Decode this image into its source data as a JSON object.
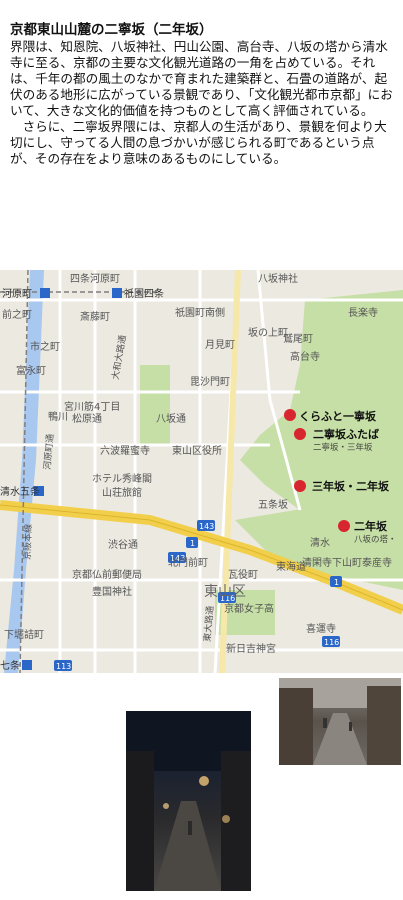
{
  "article": {
    "title": "京都東山山麓の二寧坂（二年坂）",
    "paragraph1": "界隈は、知恩院、八坂神社、円山公園、高台寺、八坂の塔から清水寺に至る、京都の主要な文化観光道路の一角を占めている。それは、千年の都の風土のなかで育まれた建築群と、石畳の道路が、起伏のある地形に広がっている景観であり、「文化観光都市京都」において、大きな文化的価値を持つものとして高く評価されている。",
    "paragraph2": "　さらに、二寧坂界隈には、京都人の生活があり、景観を何より大切にし、守ってる人間の息づかいが感じられる町であるという点が、その存在をより意味のあるものにしている。"
  },
  "map": {
    "labels": {
      "shijo_kawaramachi_top": "四条河原町",
      "kawaramachi_station": "河原町",
      "gion_shijo_station": "祇園四条",
      "yasaka_jinja": "八坂神社",
      "saitocho": "斎藤町",
      "nijocho": "前之町",
      "gion_machi_minamigawa": "祇園町南側",
      "chorakuji": "長楽寺",
      "sakanouecho": "坂の上町",
      "washiocho": "鷲尾町",
      "ichinocho": "市之町",
      "tsukimicho": "月見町",
      "kodaiji": "高台寺",
      "tominagacho": "富永町",
      "yamatooji": "大和大路通",
      "bishamoncho": "毘沙門町",
      "miyagawa4": "宮川筋4丁目",
      "yasaka_dori": "八坂通",
      "kawaramachi_dori": "河原町通",
      "matsubaracho": "松原通",
      "kamogawa": "鴨川",
      "rokuharamitsuji": "六波羅蜜寺",
      "higashiyama_ward_office": "東山区役所",
      "kiyomizu_gojo_station": "清水五条",
      "hotel_shukeiko": "ホテル秀峰閣",
      "sanjoku": "山荘旅館",
      "gojo_dori": "五条通",
      "keihan_line": "京阪本線",
      "shibutani": "渋谷通",
      "kyoto_bukko_post": "京都仏前郵便局",
      "toyokuni": "豊国神社",
      "kitamonmae": "北門前町",
      "kiyomizu": "清水",
      "seikanji": "清閑寺下山町",
      "taisanji": "泰産寺",
      "higashiyama_ku": "東山区",
      "kyoto_joshi": "京都女子高",
      "tokaido": "東海道",
      "kamemachi": "瓦役町",
      "shimohoricho": "下堀詰町",
      "shichijo_station": "七条",
      "shin_hiyoshi": "新日吉神宮",
      "kitasuge": "喜運寺",
      "higashi_oji": "東大路通",
      "gojozaka": "五条坂",
      "ichiban_route": "143",
      "route_1a": "1",
      "route_1b": "1",
      "route_113": "113",
      "route_116a": "116",
      "route_116b": "116",
      "route_143b": "143",
      "yasaka_no_to": "八坂の塔・"
    },
    "markers": {
      "kurafuto": "くらふと一寧坂",
      "futaba": "二寧坂ふたば",
      "futaba_sub": "二寧坂・三年坂",
      "sannenzaka": "三年坂・二年坂",
      "ninenzaka": "二年坂"
    },
    "colors": {
      "land": "#ece9e1",
      "park": "#c6dfa6",
      "water": "#a9c8ef",
      "highway": "#f2cf4a",
      "road": "#ffffff",
      "marker": "#d8262e"
    }
  },
  "photos": {
    "night_alley": "night-photo-icon",
    "street": "street-photo-icon"
  }
}
